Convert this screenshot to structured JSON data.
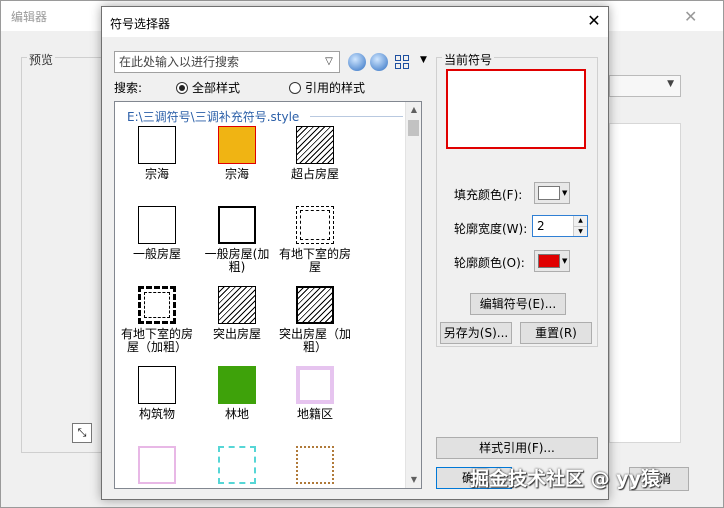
{
  "editor": {
    "title": "编辑器",
    "preview_label": "预览",
    "cancel_label": "取消"
  },
  "dialog": {
    "title": "符号选择器",
    "close_glyph": "✕",
    "search": {
      "placeholder": "在此处输入以进行搜索",
      "scope_label": "搜索:",
      "option_all": "全部样式",
      "option_ref": "引用的样式",
      "selected_option": "全部样式"
    },
    "path": "E:\\三调符号\\三调补充符号.style",
    "symbols": [
      {
        "label": "宗海",
        "style": "plain"
      },
      {
        "label": "宗海",
        "style": "orange"
      },
      {
        "label": "超占房屋",
        "style": "hatch"
      },
      {
        "label": "一般房屋",
        "style": "plain"
      },
      {
        "label": "一般房屋(加粗)",
        "style": "bold"
      },
      {
        "label": "有地下室的房屋",
        "style": "dashed"
      },
      {
        "label": "有地下室的房屋（加粗）",
        "style": "dashedbold"
      },
      {
        "label": "突出房屋",
        "style": "hatch"
      },
      {
        "label": "突出房屋（加粗）",
        "style": "hatchbold"
      },
      {
        "label": "构筑物",
        "style": "plain"
      },
      {
        "label": "林地",
        "style": "green"
      },
      {
        "label": "地籍区",
        "style": "pink"
      },
      {
        "label": "",
        "style": "lpink"
      },
      {
        "label": "",
        "style": "cyan"
      },
      {
        "label": "",
        "style": "brown"
      }
    ],
    "current_symbol": {
      "label": "当前符号",
      "fill_color_label": "填充颜色(F):",
      "fill_color": "#ffffff",
      "outline_width_label": "轮廓宽度(W):",
      "outline_width": "2",
      "outline_color_label": "轮廓颜色(O):",
      "outline_color": "#e00000"
    },
    "buttons": {
      "edit_symbol": "编辑符号(E)...",
      "save_as": "另存为(S)...",
      "reset": "重置(R)",
      "style_reference": "样式引用(F)...",
      "ok": "确定"
    }
  },
  "watermark": "掘金技术社区 @ yy猿"
}
